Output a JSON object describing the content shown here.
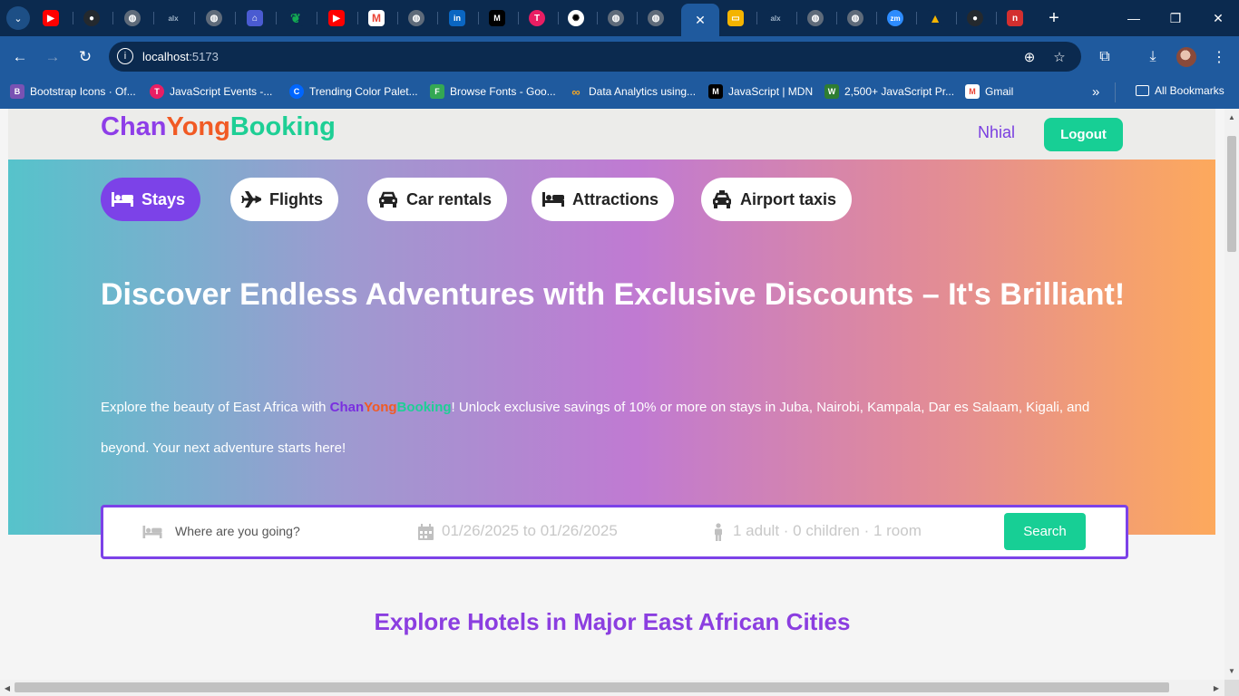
{
  "browser": {
    "url_host": "localhost",
    "url_port": ":5173",
    "tabs": [
      {
        "icon": "youtube-icon",
        "color": "#ff0000"
      },
      {
        "icon": "github-icon",
        "color": "#24292e"
      },
      {
        "icon": "globe-icon",
        "color": "#5f6b7a"
      },
      {
        "icon": "alx-icon",
        "color": "#0b2a4f"
      },
      {
        "icon": "globe-icon",
        "color": "#5f6b7a"
      },
      {
        "icon": "bank-icon",
        "color": "#4a5bd1"
      },
      {
        "icon": "mongodb-icon",
        "color": "#13aa52"
      },
      {
        "icon": "youtube-icon",
        "color": "#ff0000"
      },
      {
        "icon": "gmail-icon",
        "color": "#ea4335"
      }
    ],
    "bookmarks": [
      {
        "label": "Bootstrap Icons · Of...",
        "icon": "bootstrap-icon",
        "color": "#7952b3",
        "glyph": "B"
      },
      {
        "label": "JavaScript Events -...",
        "icon": "tpoint-icon",
        "color": "#e91e63",
        "glyph": "T"
      },
      {
        "label": "Trending Color Palet...",
        "icon": "coolors-icon",
        "color": "#0066ff",
        "glyph": "C"
      },
      {
        "label": "Browse Fonts - Goo...",
        "icon": "google-fonts-icon",
        "color": "#34a853",
        "glyph": "F"
      },
      {
        "label": "Data Analytics using...",
        "icon": "coursera-icon",
        "color": "#f5a623",
        "glyph": "∞"
      },
      {
        "label": "JavaScript | MDN",
        "icon": "mdn-icon",
        "color": "#000000",
        "glyph": "M"
      },
      {
        "label": "2,500+ JavaScript Pr...",
        "icon": "w3resource-icon",
        "color": "#2e7d32",
        "glyph": "W"
      },
      {
        "label": "Gmail",
        "icon": "gmail-icon",
        "color": "#ea4335",
        "glyph": "M"
      }
    ],
    "all_bookmarks": "All Bookmarks"
  },
  "navbar": {
    "logo_chan": "Chan",
    "logo_yong": "Yong",
    "logo_booking": "Booking",
    "user_name": "Nhial",
    "logout_label": "Logout"
  },
  "categories": [
    {
      "label": "Stays",
      "icon": "bed-icon",
      "active": true
    },
    {
      "label": "Flights",
      "icon": "plane-icon",
      "active": false
    },
    {
      "label": "Car rentals",
      "icon": "car-icon",
      "active": false
    },
    {
      "label": "Attractions",
      "icon": "bed-icon",
      "active": false
    },
    {
      "label": "Airport taxis",
      "icon": "taxi-icon",
      "active": false
    }
  ],
  "hero": {
    "title": "Discover Endless Adventures with Exclusive Discounts – It's Brilliant!",
    "text_before": "Explore the beauty of East Africa with ",
    "brand_chan": "Chan",
    "brand_yong": "Yong",
    "brand_booking": "Booking",
    "text_after": "! Unlock exclusive savings of 10% or more on stays in Juba, Nairobi, Kampala, Dar es Salaam, Kigali, and",
    "text_line2": "beyond. Your next adventure starts here!"
  },
  "search": {
    "destination_placeholder": "Where are you going?",
    "dates": "01/26/2025 to 01/26/2025",
    "guests": "1 adult · 0 children · 1 room",
    "button_label": "Search"
  },
  "section": {
    "title": "Explore Hotels in Major East African Cities"
  }
}
